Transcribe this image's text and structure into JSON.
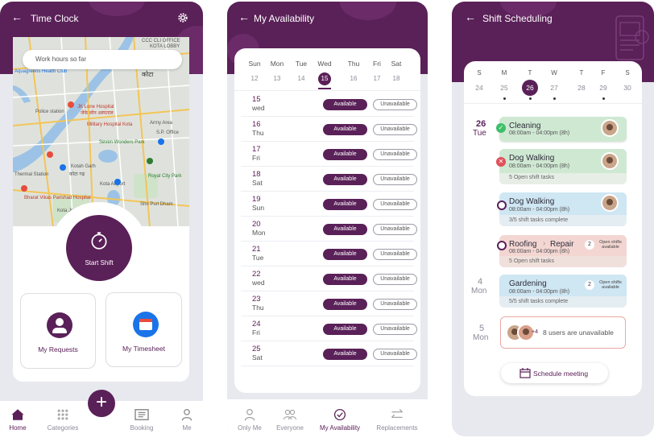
{
  "time_clock": {
    "title": "Time Clock",
    "search_placeholder": "Work hours so far",
    "start_label": "Start Shift",
    "tile_requests": "My Requests",
    "tile_timesheet": "My Timesheet",
    "map_labels": [
      "CCC CLI OFFICE",
      "KOTA LOBBY",
      "कोटा",
      "Aquagreens Health Club",
      "Police station",
      "JK Lone Hospital",
      "जेके लोन अस्पताल",
      "Military Hospital Kota",
      "Army Area",
      "S.P. Office",
      "Seven Wonders Park",
      "Kotah Garh",
      "कोटा गढ़",
      "Kota Airport",
      "Thermal Station",
      "Royal City Park",
      "Shri Purl Dham",
      "Bharat Vikas Parishad Hospital",
      "Kota Jn"
    ],
    "tabs": [
      {
        "label": "Home",
        "active": true
      },
      {
        "label": "Categories",
        "active": false
      },
      {
        "label": "Booking",
        "active": false
      },
      {
        "label": "Me",
        "active": false
      }
    ],
    "fab": "+"
  },
  "availability": {
    "title": "My Availability",
    "week": [
      {
        "day": "Sun",
        "num": "12"
      },
      {
        "day": "Mon",
        "num": "13"
      },
      {
        "day": "Tue",
        "num": "14"
      },
      {
        "day": "Wed",
        "num": "15",
        "selected": true
      },
      {
        "day": "Thu",
        "num": "16"
      },
      {
        "day": "Fri",
        "num": "17"
      },
      {
        "day": "Sat",
        "num": "18"
      }
    ],
    "rows": [
      {
        "num": "15",
        "day": "wed"
      },
      {
        "num": "16",
        "day": "Thu"
      },
      {
        "num": "17",
        "day": "Fri"
      },
      {
        "num": "18",
        "day": "Sat"
      },
      {
        "num": "19",
        "day": "Sun"
      },
      {
        "num": "20",
        "day": "Mon"
      },
      {
        "num": "21",
        "day": "Tue"
      },
      {
        "num": "22",
        "day": "wed"
      },
      {
        "num": "23",
        "day": "Thu"
      },
      {
        "num": "24",
        "day": "Fri"
      },
      {
        "num": "25",
        "day": "Sat"
      }
    ],
    "available_label": "Available",
    "unavailable_label": "Unavailable",
    "tabs": [
      "Only Me",
      "Everyone",
      "My Availability",
      "Replacements"
    ],
    "active_tab": "My Availability"
  },
  "scheduling": {
    "title": "Shift Scheduling",
    "week": [
      {
        "day": "S",
        "num": "24",
        "dot": false
      },
      {
        "day": "M",
        "num": "25",
        "dot": true
      },
      {
        "day": "T",
        "num": "26",
        "dot": true,
        "selected": true
      },
      {
        "day": "W",
        "num": "27",
        "dot": true
      },
      {
        "day": "T",
        "num": "28",
        "dot": false
      },
      {
        "day": "F",
        "num": "29",
        "dot": true
      },
      {
        "day": "S",
        "num": "30",
        "dot": false
      }
    ],
    "date1_num": "26",
    "date1_day": "Tue",
    "date2_num": "4",
    "date2_day": "Mon",
    "date3_num": "5",
    "date3_day": "Mon",
    "tasks": {
      "cleaning": {
        "name": "Cleaning",
        "time": "08:00am - 04:00pm (8h)"
      },
      "dog1": {
        "name": "Dog Walking",
        "time": "08:00am - 04:00pm (8h)",
        "foot": "5 Open shift tasks"
      },
      "dog2": {
        "name": "Dog Walking",
        "time": "08:00am - 04:00pm (8h)",
        "foot": "3/5 shift tasks complete"
      },
      "roofing": {
        "name": "Roofing",
        "name2": "Repair",
        "time": "08:00am - 04:00pm (8h)",
        "foot": "5 Open shift tasks",
        "badge": "2",
        "badge_text": "Open shifts available"
      },
      "gardening": {
        "name": "Gardening",
        "time": "08:00am - 04:00pm (8h)",
        "foot": "5/5 shift tasks complete",
        "badge": "2",
        "badge_text": "Open shifts available"
      }
    },
    "unavailable": {
      "count": "+4",
      "text": "8 users are unavailable"
    },
    "schedule_button": "Schedule meeting",
    "colors": {
      "primary": "#5a2058",
      "green": "#cfe8d2",
      "blue": "#cfe6f3",
      "pink": "#f3d6d2",
      "check": "#3fbf6a",
      "cross": "#e0505a"
    }
  }
}
